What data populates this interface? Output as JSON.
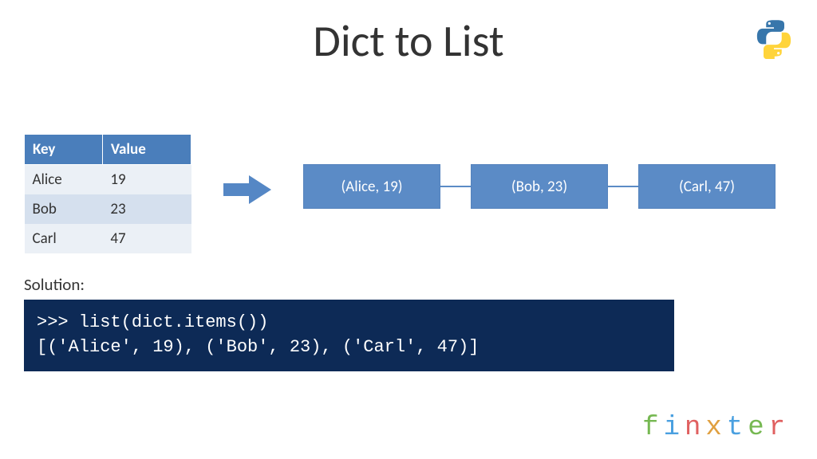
{
  "title": "Dict to List",
  "table": {
    "headers": [
      "Key",
      "Value"
    ],
    "rows": [
      {
        "k": "Alice",
        "v": "19"
      },
      {
        "k": "Bob",
        "v": "23"
      },
      {
        "k": "Carl",
        "v": "47"
      }
    ]
  },
  "nodes": [
    "(Alice, 19)",
    "(Bob, 23)",
    "(Carl, 47)"
  ],
  "solution_label": "Solution:",
  "code": ">>> list(dict.items())\n[('Alice', 19), ('Bob', 23), ('Carl', 47)]",
  "logo_name": "python-logo",
  "brand": [
    "f",
    "i",
    "n",
    "x",
    "t",
    "e",
    "r"
  ],
  "chart_data": {
    "type": "table",
    "columns": [
      "Key",
      "Value"
    ],
    "rows": [
      [
        "Alice",
        19
      ],
      [
        "Bob",
        23
      ],
      [
        "Carl",
        47
      ]
    ]
  }
}
